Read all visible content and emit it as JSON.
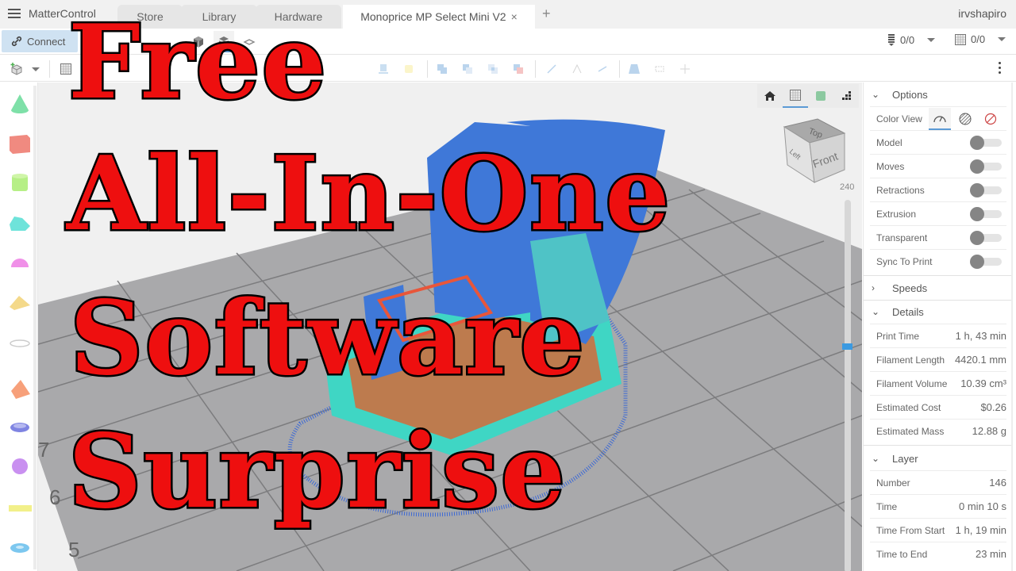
{
  "app": {
    "name": "MatterControl",
    "user": "irvshapiro"
  },
  "tabs": [
    {
      "label": "Store"
    },
    {
      "label": "Library"
    },
    {
      "label": "Hardware"
    },
    {
      "label": "Monoprice MP Select Mini V2",
      "active": true,
      "close": "×"
    }
  ],
  "tab_add": "+",
  "printer_bar": {
    "connect_label": "Connect",
    "views": [
      {
        "icon": "model-view-icon",
        "active": false
      },
      {
        "icon": "layers-3d-view-icon",
        "active": true
      },
      {
        "icon": "layers-2d-view-icon",
        "active": false
      }
    ],
    "extruder_counter": "0/0",
    "bed_counter": "0/0"
  },
  "toolbar": {
    "more_icon": "more-vertical-icon"
  },
  "shapes": [
    {
      "name": "cone",
      "color": "#7ee0a8"
    },
    {
      "name": "cube",
      "color": "#f08a80"
    },
    {
      "name": "cylinder",
      "color": "#b6ef86"
    },
    {
      "name": "half-cylinder",
      "color": "#6ee3da"
    },
    {
      "name": "half-sphere",
      "color": "#f090e8"
    },
    {
      "name": "wedge",
      "color": "#f4d98a"
    },
    {
      "name": "text-outline",
      "color": "#dddddd"
    },
    {
      "name": "pyramid",
      "color": "#f7a07a"
    },
    {
      "name": "ring",
      "color": "#7f84e2"
    },
    {
      "name": "sphere",
      "color": "#c990f0"
    },
    {
      "name": "text",
      "color": "#f2f08a"
    },
    {
      "name": "torus",
      "color": "#7cc7ef"
    }
  ],
  "viewport": {
    "view_controls": [
      {
        "icon": "home-icon",
        "active": false
      },
      {
        "icon": "grid-icon",
        "active": true
      },
      {
        "icon": "model-icon",
        "active": false
      },
      {
        "icon": "layers-icon",
        "active": false
      }
    ],
    "nav_cube": {
      "top": "Top",
      "front": "Front",
      "left": "Left"
    },
    "layer_slider": {
      "max_label": "240",
      "current_layer": 146,
      "max_layer": 240
    },
    "bed_labels": [
      "7",
      "6",
      "5"
    ]
  },
  "overlay": {
    "lines": [
      "Free",
      "All-In-One",
      "Software",
      "Surprise"
    ],
    "color": "#ee0f0f"
  },
  "panel": {
    "options": {
      "title": "Options",
      "color_view_label": "Color View",
      "color_view_modes": [
        {
          "icon": "speed-gauge-icon",
          "active": true
        },
        {
          "icon": "material-hatch-icon",
          "active": false
        },
        {
          "icon": "no-color-icon",
          "active": false
        }
      ],
      "toggles": [
        {
          "label": "Model",
          "on": false
        },
        {
          "label": "Moves",
          "on": false
        },
        {
          "label": "Retractions",
          "on": false
        },
        {
          "label": "Extrusion",
          "on": false
        },
        {
          "label": "Transparent",
          "on": false
        },
        {
          "label": "Sync To Print",
          "on": false
        }
      ]
    },
    "speeds": {
      "title": "Speeds"
    },
    "details": {
      "title": "Details",
      "rows": [
        {
          "label": "Print Time",
          "value": "1 h, 43 min"
        },
        {
          "label": "Filament Length",
          "value": "4420.1 mm"
        },
        {
          "label": "Filament Volume",
          "value": "10.39 cm³"
        },
        {
          "label": "Estimated Cost",
          "value": "$0.26"
        },
        {
          "label": "Estimated Mass",
          "value": "12.88 g"
        }
      ]
    },
    "layer": {
      "title": "Layer",
      "rows": [
        {
          "label": "Number",
          "value": "146"
        },
        {
          "label": "Time",
          "value": "0 min 10 s"
        },
        {
          "label": "Time From Start",
          "value": "1 h, 19 min"
        },
        {
          "label": "Time to End",
          "value": "23 min"
        }
      ]
    }
  }
}
